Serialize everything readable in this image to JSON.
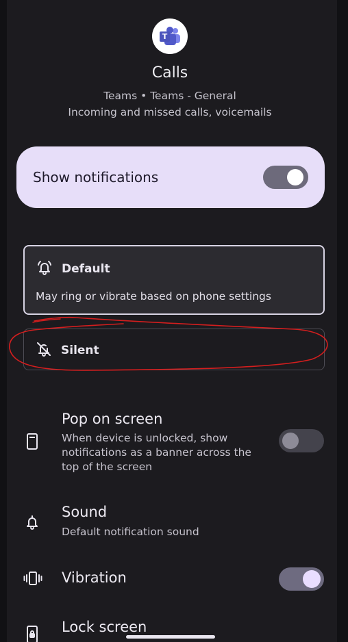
{
  "header": {
    "app_icon": "microsoft-teams-icon",
    "title": "Calls",
    "subtitle_line1": "Teams • Teams - General",
    "subtitle_line2": "Incoming and missed calls, voicemails"
  },
  "show_notifications": {
    "label": "Show notifications",
    "enabled": true
  },
  "behavior_options": [
    {
      "label": "Default",
      "description": "May ring or vibrate based on phone settings",
      "icon": "bell-ring-icon",
      "selected": true
    },
    {
      "label": "Silent",
      "icon": "bell-off-icon",
      "selected": false
    }
  ],
  "settings": {
    "pop_on_screen": {
      "title": "Pop on screen",
      "description": "When device is unlocked, show notifications as a banner across the top of the screen",
      "icon": "phone-screen-icon",
      "enabled": false
    },
    "sound": {
      "title": "Sound",
      "description": "Default notification sound",
      "icon": "bell-icon"
    },
    "vibration": {
      "title": "Vibration",
      "icon": "vibration-icon",
      "enabled": true
    },
    "lock_screen": {
      "title": "Lock screen",
      "icon": "lock-screen-icon"
    }
  },
  "colors": {
    "background": "#1c1b1f",
    "card_accent": "#e7def9",
    "annotation": "#d41e1e"
  }
}
